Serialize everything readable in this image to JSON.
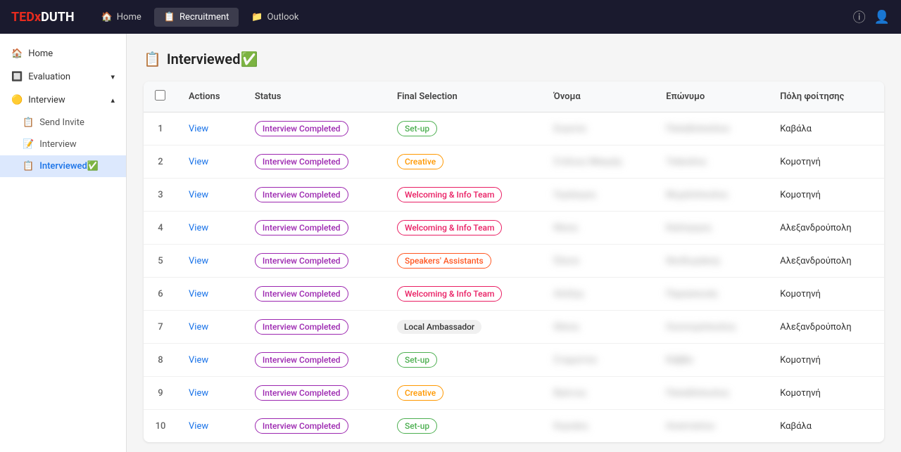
{
  "brand": {
    "tedx": "TEDx",
    "duth": "DUTH"
  },
  "topnav": {
    "items": [
      {
        "label": "Home",
        "icon": "🏠",
        "active": false
      },
      {
        "label": "Recruitment",
        "icon": "📋",
        "active": true
      },
      {
        "label": "Outlook",
        "icon": "📁",
        "active": false
      }
    ],
    "icon_help": "?",
    "icon_user": "👤"
  },
  "sidebar": {
    "home_label": "Home",
    "evaluation_label": "Evaluation",
    "interview_label": "Interview",
    "send_invite_label": "Send Invite",
    "interview_sub_label": "Interview",
    "interviewed_label": "Interviewed✅"
  },
  "page": {
    "title": "Interviewed✅",
    "title_icon": "📋"
  },
  "table": {
    "columns": [
      "",
      "Actions",
      "Status",
      "Final Selection",
      "Όνομα",
      "Επώνυμο",
      "Πόλη φοίτησης"
    ],
    "rows": [
      {
        "num": 1,
        "action": "View",
        "status": "Interview Completed",
        "status_type": "interview",
        "selection": "Set-up",
        "selection_type": "setup",
        "first_name": "Ευγενία",
        "last_name": "Παπαδοπούλου",
        "city": "Καβάλα"
      },
      {
        "num": 2,
        "action": "View",
        "status": "Interview Completed",
        "status_type": "interview",
        "selection": "Creative",
        "selection_type": "creative",
        "first_name": "Στέλιος Μακρής",
        "last_name": "Τσάκαλος",
        "city": "Κομοτηνή"
      },
      {
        "num": 3,
        "action": "View",
        "status": "Interview Completed",
        "status_type": "interview",
        "selection": "Welcoming & Info Team",
        "selection_type": "welcoming",
        "first_name": "Γεράσιμος",
        "last_name": "Μιχαλόπουλος",
        "city": "Κομοτηνή"
      },
      {
        "num": 4,
        "action": "View",
        "status": "Interview Completed",
        "status_type": "interview",
        "selection": "Welcoming & Info Team",
        "selection_type": "welcoming",
        "first_name": "Νίκος",
        "last_name": "Καλόγερος",
        "city": "Αλεξανδρούπολη"
      },
      {
        "num": 5,
        "action": "View",
        "status": "Interview Completed",
        "status_type": "interview",
        "selection": "Speakers' Assistants",
        "selection_type": "speakers",
        "first_name": "Έλενα",
        "last_name": "Θεοδωράκης",
        "city": "Αλεξανδρούπολη"
      },
      {
        "num": 6,
        "action": "View",
        "status": "Interview Completed",
        "status_type": "interview",
        "selection": "Welcoming & Info Team",
        "selection_type": "welcoming",
        "first_name": "Αλέξης",
        "last_name": "Παρασκευάς",
        "city": "Κομοτηνή"
      },
      {
        "num": 7,
        "action": "View",
        "status": "Interview Completed",
        "status_type": "interview",
        "selection": "Local Ambassador",
        "selection_type": "ambassador",
        "first_name": "Θάνος",
        "last_name": "Οικονομόπουλος",
        "city": "Αλεξανδρούπολη"
      },
      {
        "num": 8,
        "action": "View",
        "status": "Interview Completed",
        "status_type": "interview",
        "selection": "Set-up",
        "selection_type": "setup",
        "first_name": "Σταματίνα",
        "last_name": "Κάββα",
        "city": "Κομοτηνή"
      },
      {
        "num": 9,
        "action": "View",
        "status": "Interview Completed",
        "status_type": "interview",
        "selection": "Creative",
        "selection_type": "creative",
        "first_name": "Βγένιος",
        "last_name": "Παπαδόπουλος",
        "city": "Κομοτηνή"
      },
      {
        "num": 10,
        "action": "View",
        "status": "Interview Completed",
        "status_type": "interview",
        "selection": "Set-up",
        "selection_type": "setup",
        "first_name": "Κυριάκη",
        "last_name": "Αναστασίου",
        "city": "Καβάλα"
      }
    ]
  }
}
